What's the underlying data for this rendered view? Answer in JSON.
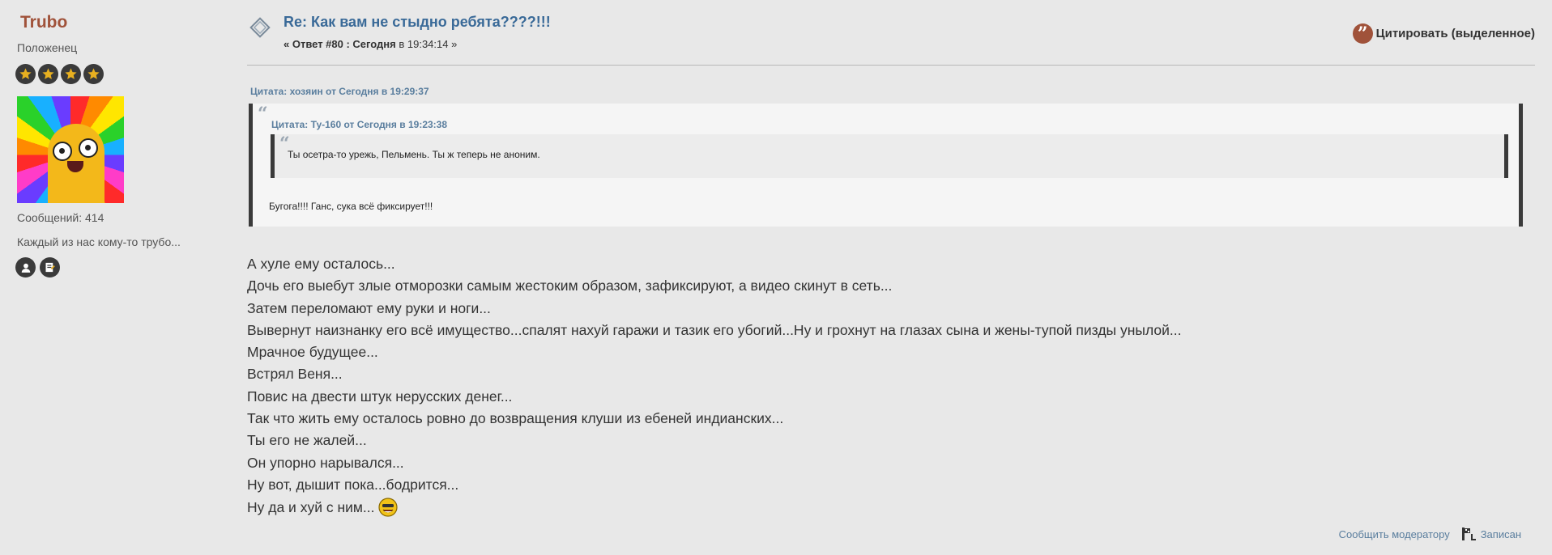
{
  "author": {
    "name": "Trubo",
    "rank": "Положенец",
    "stars": 4,
    "posts_label": "Сообщений: 414",
    "blurb": "Каждый из нас кому-то трубо...",
    "icons": [
      "profile-icon",
      "personal-message-icon"
    ]
  },
  "post": {
    "title": "Re: Как вам не стыдно ребята????!!!",
    "meta_prefix": "« Ответ #80 : Сегодня",
    "meta_time": " в 19:34:14 »",
    "quote_button": "Цитировать (выделенное)",
    "outer_quote_header": "Цитата: хозяин от Сегодня в 19:29:37",
    "inner_quote_header": "Цитата: Ту-160 от Сегодня в 19:23:38",
    "inner_quote_text": "Ты осетра-то урежь, Пельмень. Ты ж теперь не аноним.",
    "outer_quote_text": "Бугога!!!! Ганс, сука всё фиксирует!!!",
    "lines": [
      "А хуле ему осталось...",
      "Дочь его выебут злые отморозки самым жестоким образом, зафиксируют, а видео скинут в сеть...",
      "Затем переломают ему руки и ноги...",
      "Вывернут наизнанку его всё имущество...спалят нахуй гаражи и тазик его убогий...Ну и грохнут на глазах сына и жены-тупой пизды унылой...",
      "Мрачное будущее...",
      "Встрял Веня...",
      "Повис на двести штук нерусских денег...",
      "Так что жить ему осталось ровно до возвращения клуши из ебеней индианских...",
      "Ты его не жалей...",
      "Он упорно нарывался...",
      "Ну вот, дышит пока...бодрится...",
      "Ну да и хуй с ним..."
    ]
  },
  "footer": {
    "report": "Сообщить модератору",
    "logged": "Записан"
  },
  "colors": {
    "background": "#e8e8e8",
    "author_name": "#a0523a",
    "title": "#3a6a98",
    "link": "#5a7e9e"
  }
}
